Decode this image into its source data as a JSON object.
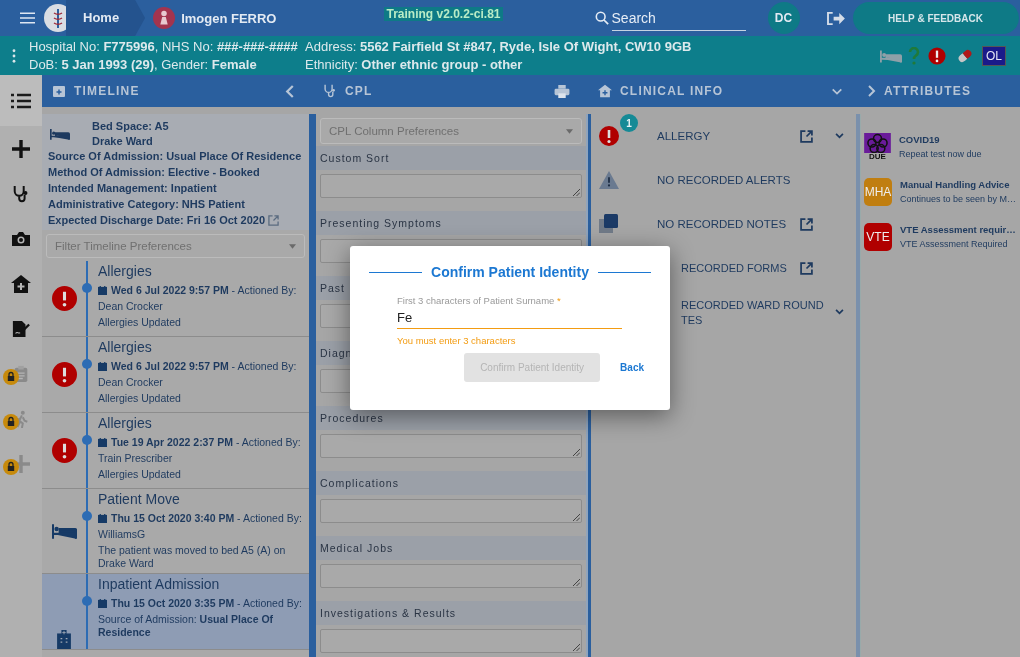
{
  "top_bar": {
    "home": "Home",
    "patient_name": "Imogen FERRO",
    "version": "Training v2.0.2-ci.81",
    "search_placeholder": "Search",
    "user_initials": "DC",
    "help": "HELP & FEEDBACK"
  },
  "patient_bar": {
    "line_1": "Hospital No: **F775996**, NHS No: **###-###-####**",
    "address": "Address: **5562 Fairfield St #847, Ryde, Isle Of Wight, CW10 9GB**",
    "line_2": "DoB: **5 Jan 1993 (29)**, Gender: **Female**",
    "ethnicity": "Ethnicity: **Other ethnic group - other**",
    "badge": "OL"
  },
  "side_rail": [
    {
      "kind": "list",
      "selected": true,
      "locked": false
    },
    {
      "kind": "plus",
      "selected": false,
      "locked": false
    },
    {
      "kind": "stethoscope",
      "selected": false,
      "locked": false
    },
    {
      "kind": "camera",
      "selected": false,
      "locked": false
    },
    {
      "kind": "home",
      "selected": false,
      "locked": false
    },
    {
      "kind": "signature",
      "selected": false,
      "locked": false
    },
    {
      "kind": "clipboard",
      "selected": false,
      "locked": true
    },
    {
      "kind": "walker",
      "selected": false,
      "locked": true
    },
    {
      "kind": "plus",
      "selected": false,
      "locked": true
    }
  ],
  "timeline": {
    "title": "TIMELINE",
    "bed_space": "Bed Space: A5",
    "ward": "Drake Ward",
    "details": [
      "Source Of Admission: Usual Place Of Residence",
      "Method Of Admission: Elective - Booked",
      "Intended Management: Inpatient",
      "Administrative Category: NHS Patient"
    ],
    "discharge": "Expected Discharge Date: Fri 16 Oct 2020",
    "filter_placeholder": "Filter Timeline Preferences",
    "entries": [
      {
        "kind": "allergy",
        "selected": false,
        "title": "Allergies",
        "date": "**Wed 6 Jul 2022 9:57 PM** - Actioned By:",
        "lines": [
          "Dean Crocker",
          "Allergies Updated"
        ]
      },
      {
        "kind": "allergy",
        "selected": false,
        "title": "Allergies",
        "date": "**Wed 6 Jul 2022 9:57 PM** - Actioned By:",
        "lines": [
          "Dean Crocker",
          "Allergies Updated"
        ]
      },
      {
        "kind": "allergy",
        "selected": false,
        "title": "Allergies",
        "date": "**Tue 19 Apr 2022 2:37 PM** - Actioned By:",
        "lines": [
          "Train Prescriber",
          "Allergies Updated"
        ]
      },
      {
        "kind": "move",
        "selected": false,
        "title": "Patient Move",
        "date": "**Thu 15 Oct 2020 3:40 PM** - Actioned By:",
        "lines": [
          "WilliamsG",
          "The patient was moved to bed A5 (A) on Drake Ward"
        ]
      },
      {
        "kind": "admission",
        "selected": true,
        "title": "Inpatient Admission",
        "date": "**Thu 15 Oct 2020 3:35 PM** - Actioned By:",
        "lines": [
          "Source of Admission: **Usual Place Of Residence**"
        ]
      }
    ]
  },
  "cpl": {
    "title": "CPL",
    "select_placeholder": "CPL Column Preferences",
    "sections": [
      {
        "label": "Custom Sort",
        "kind": "field"
      },
      {
        "label": "Presenting Symptoms",
        "kind": "covered"
      },
      {
        "label": "Past",
        "kind": "covered"
      },
      {
        "label": "Diagn",
        "kind": "covered"
      },
      {
        "label": "Procedures",
        "kind": "field"
      },
      {
        "label": "Complications",
        "kind": "field"
      },
      {
        "label": "Medical Jobs",
        "kind": "field"
      },
      {
        "label": "Investigations & Results",
        "kind": "field"
      }
    ]
  },
  "clinical_info": {
    "title": "CLINICAL INFO",
    "items": [
      {
        "kind": "allergy",
        "lines": [
          "ALLERGY"
        ],
        "count": "1",
        "external": true,
        "expandable": true
      },
      {
        "kind": "alerts",
        "lines": [
          "NO RECORDED ALERTS"
        ],
        "external": false,
        "expandable": false
      },
      {
        "kind": "notes",
        "lines": [
          "NO RECORDED NOTES"
        ],
        "external": true,
        "expandable": false
      },
      {
        "kind": "covered",
        "lines": [
          "RECORDED FORMS"
        ],
        "external": true,
        "expandable": false
      },
      {
        "kind": "covered",
        "lines": [
          "RECORDED WARD ROUND",
          "TES"
        ],
        "external": false,
        "expandable": true
      }
    ]
  },
  "attributes": {
    "title": "ATTRIBUTES",
    "items": [
      {
        "kind": "covid",
        "badge": "DUE",
        "title": "COVID19",
        "subtitle": "Repeat test now due",
        "color": "#6a1b9a"
      },
      {
        "kind": "text",
        "badge": "MHA",
        "title": "Manual Handling Advice",
        "subtitle": "Continues to be seen by M…",
        "color": "#c07e10"
      },
      {
        "kind": "text",
        "badge": "VTE",
        "title": "VTE Assessment requir…",
        "subtitle": "VTE Assessment Required",
        "color": "#b00000"
      }
    ]
  },
  "dialog": {
    "title": "Confirm Patient Identity",
    "field_label": "First 3 characters of Patient Surname",
    "required_mark": "*",
    "value": "Fe",
    "error": "You must enter 3 characters",
    "confirm": {
      "label": "Confirm Patient Identity",
      "disabled": true
    },
    "back": "Back"
  }
}
